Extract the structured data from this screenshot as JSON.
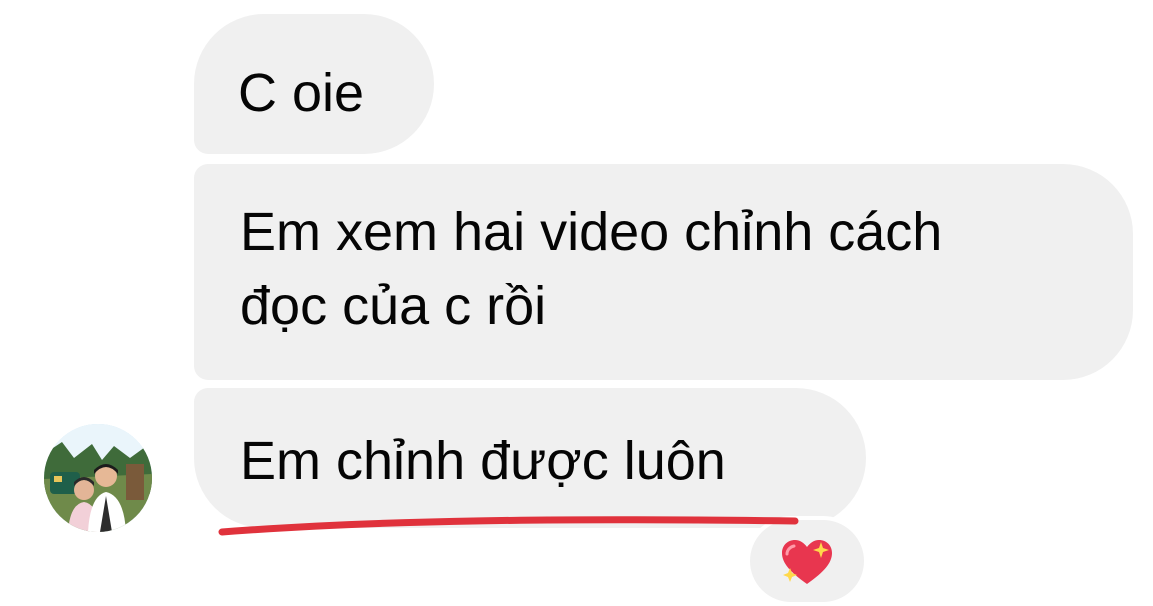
{
  "conversation": {
    "messages": [
      {
        "lines": [
          "C oie"
        ]
      },
      {
        "lines": [
          "Em xem hai video chỉnh cách",
          "đọc của c rồi"
        ]
      },
      {
        "lines": [
          "Em chỉnh được luôn"
        ]
      }
    ],
    "reaction": {
      "icon": "sparkling-heart-icon",
      "color": "#e8364f"
    },
    "annotation": {
      "color": "#e0323c"
    },
    "colors": {
      "bubble": "#f0f0f0",
      "text": "#050505"
    }
  }
}
